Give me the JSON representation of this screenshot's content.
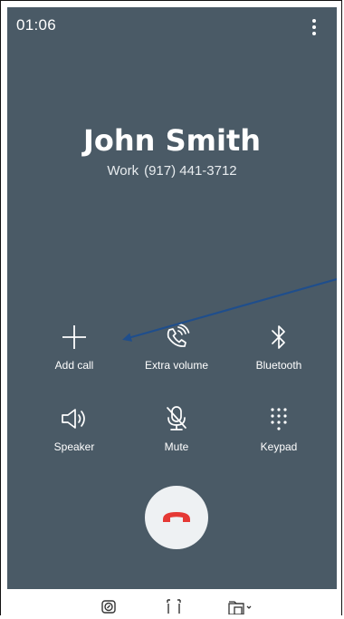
{
  "status": {
    "timer": "01:06"
  },
  "caller": {
    "name": "John Smith",
    "label": "Work",
    "number": "(917) 441-3712"
  },
  "controls": [
    {
      "label": "Add call",
      "icon": "plus-icon"
    },
    {
      "label": "Extra volume",
      "icon": "extra-volume-icon"
    },
    {
      "label": "Bluetooth",
      "icon": "bluetooth-icon"
    },
    {
      "label": "Speaker",
      "icon": "speaker-icon"
    },
    {
      "label": "Mute",
      "icon": "mute-mic-icon"
    },
    {
      "label": "Keypad",
      "icon": "keypad-icon"
    }
  ],
  "colors": {
    "background": "#4a5a66",
    "end_call": "#e53935",
    "annotation_arrow": "#1f4e8c"
  }
}
